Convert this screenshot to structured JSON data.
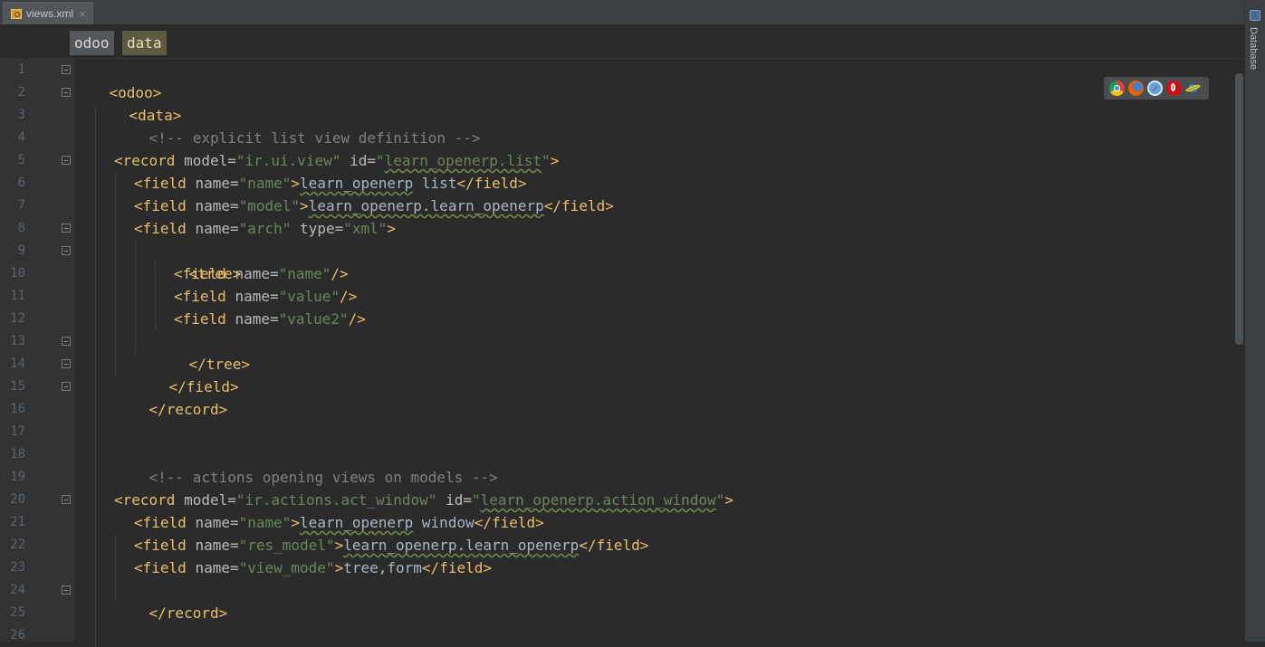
{
  "tab": {
    "filename": "views.xml",
    "close": "×"
  },
  "breadcrumb": [
    "odoo",
    "data"
  ],
  "toolstrip": {
    "label": "Database"
  },
  "line_numbers": [
    "1",
    "2",
    "3",
    "4",
    "5",
    "6",
    "7",
    "8",
    "9",
    "10",
    "11",
    "12",
    "13",
    "14",
    "15",
    "16",
    "17",
    "18",
    "19",
    "20",
    "21",
    "22",
    "23",
    "24",
    "25",
    "26"
  ],
  "code": {
    "l1": [
      "<odoo>"
    ],
    "l2": [
      "<data>"
    ],
    "l3": [
      "<!-- explicit list view definition -->"
    ],
    "l5": [
      "<record ",
      "model",
      "=",
      "\"ir.ui.view\"",
      " ",
      "id",
      "=",
      "\"",
      "learn_openerp.list",
      "\"",
      ">"
    ],
    "l6": [
      "<field ",
      "name",
      "=",
      "\"name\"",
      ">",
      "learn_openerp",
      " list",
      "</field>"
    ],
    "l7": [
      "<field ",
      "name",
      "=",
      "\"model\"",
      ">",
      "learn_openerp.learn_openerp",
      "</field>"
    ],
    "l8": [
      "<field ",
      "name",
      "=",
      "\"arch\"",
      " ",
      "type",
      "=",
      "\"xml\"",
      ">"
    ],
    "l9": [
      "<tree>"
    ],
    "l10": [
      "<field ",
      "name",
      "=",
      "\"name\"",
      "/>"
    ],
    "l11": [
      "<field ",
      "name",
      "=",
      "\"value\"",
      "/>"
    ],
    "l12": [
      "<field ",
      "name",
      "=",
      "\"value2\"",
      "/>"
    ],
    "l13": [
      "</tree>"
    ],
    "l14": [
      "</field>"
    ],
    "l15": [
      "</record>"
    ],
    "l18": [
      "<!-- actions opening views on models -->"
    ],
    "l20": [
      "<record ",
      "model",
      "=",
      "\"ir.actions.act_window\"",
      " ",
      "id",
      "=",
      "\"",
      "learn_openerp.action_window",
      "\"",
      ">"
    ],
    "l21": [
      "<field ",
      "name",
      "=",
      "\"name\"",
      ">",
      "learn_openerp",
      " window",
      "</field>"
    ],
    "l22": [
      "<field ",
      "name",
      "=",
      "\"res_model\"",
      ">",
      "learn_openerp.learn_openerp",
      "</field>"
    ],
    "l23": [
      "<field ",
      "name",
      "=",
      "\"view_mode\"",
      ">",
      "tree,form",
      "</field>"
    ],
    "l24": [
      "</record>"
    ]
  },
  "inspection_status": "✔",
  "browser_icons": [
    "chrome-icon",
    "firefox-icon",
    "safari-icon",
    "opera-icon",
    "ie-icon"
  ],
  "colors": {
    "tag": "#e8bf6a",
    "attr": "#bababa",
    "value": "#6a8759",
    "comment": "#808080",
    "text": "#a9b7c6",
    "background": "#2b2b2b"
  }
}
